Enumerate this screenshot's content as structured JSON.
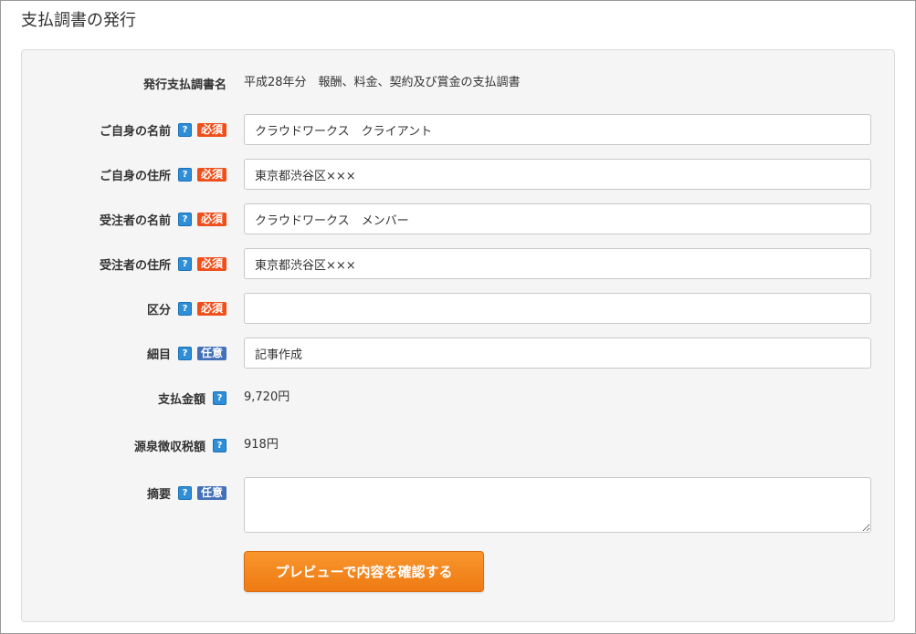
{
  "page": {
    "title": "支払調書の発行"
  },
  "form": {
    "document_name": {
      "label": "発行支払調書名",
      "value": "平成28年分　報酬、料金、契約及び賞金の支払調書"
    },
    "client_name": {
      "label": "ご自身の名前",
      "badge": "必須",
      "value": "クラウドワークス　クライアント"
    },
    "client_address": {
      "label": "ご自身の住所",
      "badge": "必須",
      "value": "東京都渋谷区×××"
    },
    "contractor_name": {
      "label": "受注者の名前",
      "badge": "必須",
      "value": "クラウドワークス　メンバー"
    },
    "contractor_address": {
      "label": "受注者の住所",
      "badge": "必須",
      "value": "東京都渋谷区×××"
    },
    "category": {
      "label": "区分",
      "badge": "必須",
      "value": ""
    },
    "details": {
      "label": "細目",
      "badge": "任意",
      "value": "記事作成"
    },
    "payment_amount": {
      "label": "支払金額",
      "value": "9,720円"
    },
    "withholding_tax": {
      "label": "源泉徴収税額",
      "value": "918円"
    },
    "summary": {
      "label": "摘要",
      "badge": "任意",
      "value": ""
    },
    "help_glyph": "?",
    "submit_label": "プレビューで内容を確認する"
  },
  "colors": {
    "required_badge": "#ee4f1b",
    "optional_badge": "#4470b8",
    "help_icon": "#2f8ed8",
    "submit_button": "#f08a1f"
  }
}
